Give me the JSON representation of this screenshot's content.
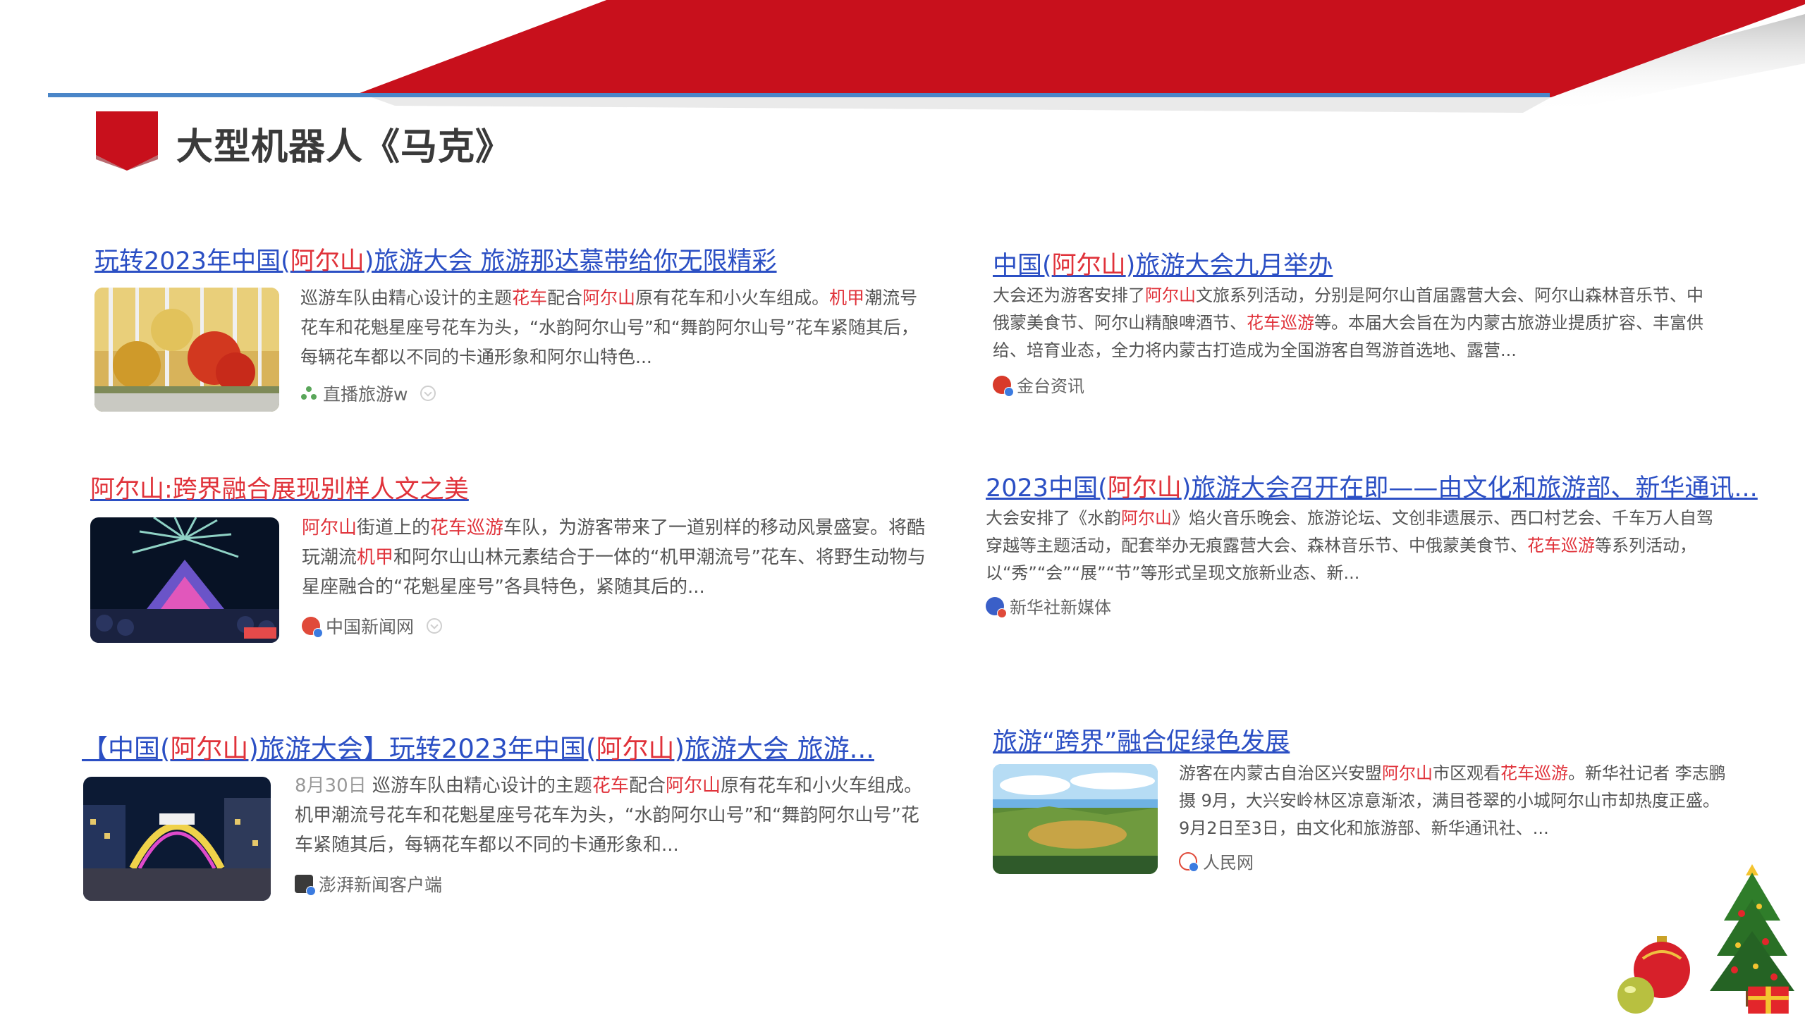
{
  "page": {
    "title": "大型机器人《马克》"
  },
  "colors": {
    "banner_red": "#c8101c",
    "rule_blue": "#4a86c8",
    "link_blue": "#2b4fc4",
    "highlight_red": "#e0323a",
    "body_gray": "#555555"
  },
  "cards": [
    {
      "title": [
        {
          "t": "玩转2023年中国("
        },
        {
          "t": "阿尔山",
          "hl": true
        },
        {
          "t": ")旅游大会 旅游那达慕带给你无限精彩"
        }
      ],
      "body": [
        {
          "t": "巡游车队由精心设计的主题"
        },
        {
          "t": "花车",
          "hl": true
        },
        {
          "t": "配合"
        },
        {
          "t": "阿尔山",
          "hl": true
        },
        {
          "t": "原有花车和小火车组成。"
        },
        {
          "t": "机甲",
          "hl": true
        },
        {
          "t": "潮流号花车和花魁星座号花车为头，“水韵阿尔山号”和“舞韵阿尔山号”花车紧随其后，每辆花车都以不同的卡通形象和阿尔山特色..."
        }
      ],
      "source": "直播旅游w",
      "source_icon": "grid-icon",
      "image": "autumn-forest-photo"
    },
    {
      "title": [
        {
          "t": "中国("
        },
        {
          "t": "阿尔山",
          "hl": true
        },
        {
          "t": ")旅游大会九月举办"
        }
      ],
      "body": [
        {
          "t": "大会还为游客安排了"
        },
        {
          "t": "阿尔山",
          "hl": true
        },
        {
          "t": "文旅系列活动，分别是阿尔山首届露营大会、阿尔山森林音乐节、中俄蒙美食节、阿尔山精酿啤酒节、"
        },
        {
          "t": "花车巡游",
          "hl": true
        },
        {
          "t": "等。本届大会旨在为内蒙古旅游业提质扩容、丰富供给、培育业态，全力将内蒙古打造成为全国游客自驾游首选地、露营..."
        }
      ],
      "source": "金台资讯",
      "source_icon": "jintai-icon",
      "image": ""
    },
    {
      "title": [
        {
          "t": "阿尔山",
          "hl": true
        },
        {
          "t": ":跨界融合展现别样人文之美",
          "hl": true
        }
      ],
      "body": [
        {
          "t": "阿尔山",
          "hl": true
        },
        {
          "t": "街道上的"
        },
        {
          "t": "花车巡游",
          "hl": true
        },
        {
          "t": "车队，为游客带来了一道别样的移动风景盛宴。将酷玩潮流"
        },
        {
          "t": "机甲",
          "hl": true
        },
        {
          "t": "和阿尔山山林元素结合于一体的“机甲潮流号”花车、将野生动物与星座融合的“花魁星座号”各具特色，紧随其后的..."
        }
      ],
      "source": "中国新闻网",
      "source_icon": "chinanews-icon",
      "image": "night-parade-photo"
    },
    {
      "title": [
        {
          "t": "2023中国("
        },
        {
          "t": "阿尔山",
          "hl": true
        },
        {
          "t": ")旅游大会召开在即——由文化和旅游部、新华通讯..."
        }
      ],
      "body": [
        {
          "t": "大会安排了《水韵"
        },
        {
          "t": "阿尔山",
          "hl": true
        },
        {
          "t": "》焰火音乐晚会、旅游论坛、文创非遗展示、西口村艺会、千车万人自驾穿越等主题活动，配套举办无痕露营大会、森林音乐节、中俄蒙美食节、"
        },
        {
          "t": "花车巡游",
          "hl": true
        },
        {
          "t": "等系列活动，以“秀”“会”“展”“节”等形式呈现文旅新业态、新..."
        }
      ],
      "source": "新华社新媒体",
      "source_icon": "xinhua-icon",
      "image": ""
    },
    {
      "title": [
        {
          "t": "【中国("
        },
        {
          "t": "阿尔山",
          "hl": true
        },
        {
          "t": ")旅游大会】玩转2023年中国("
        },
        {
          "t": "阿尔山",
          "hl": true
        },
        {
          "t": ")旅游大会 旅游..."
        }
      ],
      "date": "8月30日",
      "body": [
        {
          "t": "巡游车队由精心设计的主题"
        },
        {
          "t": "花车",
          "hl": true
        },
        {
          "t": "配合"
        },
        {
          "t": "阿尔山",
          "hl": true
        },
        {
          "t": "原有花车和小火车组成。机甲潮流号花车和花魁星座号花车为头，“水韵阿尔山号”和“舞韵阿尔山号”花车紧随其后，每辆花车都以不同的卡通形象和..."
        }
      ],
      "source": "澎湃新闻客户端",
      "source_icon": "thepaper-icon",
      "image": "night-gate-photo"
    },
    {
      "title": [
        {
          "t": "旅游“跨界”融合促绿色发展"
        }
      ],
      "body": [
        {
          "t": "游客在内蒙古自治区兴安盟"
        },
        {
          "t": "阿尔山",
          "hl": true
        },
        {
          "t": "市区观看"
        },
        {
          "t": "花车巡游",
          "hl": true
        },
        {
          "t": "。新华社记者 李志鹏摄 9月，大兴安岭林区凉意渐浓，满目苍翠的小城阿尔山市却热度正盛。9月2日至3日，由文化和旅游部、新华通讯社、..."
        }
      ],
      "source": "人民网",
      "source_icon": "peoplesdaily-icon",
      "image": "landscape-photo"
    }
  ],
  "decor": {
    "items": [
      "christmas-tree-icon",
      "ornament-ball-icon",
      "gift-box-icon"
    ]
  }
}
